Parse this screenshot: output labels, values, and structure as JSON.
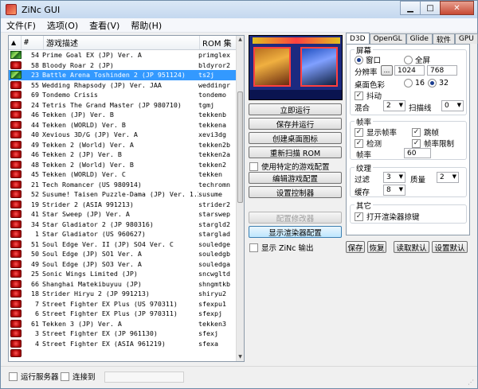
{
  "window": {
    "title": "ZiNc GUI"
  },
  "menu": [
    "文件(F)",
    "选项(O)",
    "查看(V)",
    "帮助(H)"
  ],
  "list_header": {
    "arrow": "▲",
    "num": "#",
    "desc": "游戏描述",
    "rom": "ROM 集"
  },
  "games": [
    {
      "status": "ok",
      "num": "54",
      "desc": "Prime Goal EX (JP) Ver. A",
      "rom": "primglex"
    },
    {
      "status": "bad",
      "num": "58",
      "desc": "Bloody Roar 2 (JP)",
      "rom": "bldyror2"
    },
    {
      "status": "ok",
      "num": "23",
      "desc": "Battle Arena Toshinden 2 (JP 951124)",
      "rom": "ts2j",
      "selected": true
    },
    {
      "status": "bad",
      "num": "55",
      "desc": "Wedding Rhapsody (JP) Ver. JAA",
      "rom": "weddingr"
    },
    {
      "status": "bad",
      "num": "69",
      "desc": "Tondemo Crisis",
      "rom": "tondemo"
    },
    {
      "status": "bad",
      "num": "24",
      "desc": "Tetris The Grand Master (JP 980710)",
      "rom": "tgmj"
    },
    {
      "status": "bad",
      "num": "46",
      "desc": "Tekken (JP) Ver. B",
      "rom": "tekkenb"
    },
    {
      "status": "bad",
      "num": "44",
      "desc": "Tekken (WORLD) Ver. B",
      "rom": "tekkena"
    },
    {
      "status": "bad",
      "num": "40",
      "desc": "Xevious 3D/G (JP) Ver. A",
      "rom": "xevi3dg"
    },
    {
      "status": "bad",
      "num": "49",
      "desc": "Tekken 2 (World) Ver. A",
      "rom": "tekken2b"
    },
    {
      "status": "bad",
      "num": "46",
      "desc": "Tekken 2 (JP) Ver. B",
      "rom": "tekken2a"
    },
    {
      "status": "bad",
      "num": "48",
      "desc": "Tekken 2 (World) Ver. B",
      "rom": "tekken2"
    },
    {
      "status": "bad",
      "num": "45",
      "desc": "Tekken (WORLD) Ver. C",
      "rom": "tekken"
    },
    {
      "status": "bad",
      "num": "21",
      "desc": "Tech Romancer (US 980914)",
      "rom": "techromn"
    },
    {
      "status": "bad",
      "num": "52",
      "desc": "Susume! Taisen Puzzle-Dama (JP) Ver. 1.20",
      "rom": "susume"
    },
    {
      "status": "bad",
      "num": "19",
      "desc": "Strider 2 (ASIA 991213)",
      "rom": "strider2"
    },
    {
      "status": "bad",
      "num": "41",
      "desc": "Star Sweep (JP) Ver. A",
      "rom": "starswep"
    },
    {
      "status": "bad",
      "num": "34",
      "desc": "Star Gladiator 2 (JP 980316)",
      "rom": "stargld2"
    },
    {
      "status": "bad",
      "num": "1",
      "desc": "Star Gladiator (US 960627)",
      "rom": "starglad"
    },
    {
      "status": "bad",
      "num": "51",
      "desc": "Soul Edge Ver. II (JP) SO4 Ver. C",
      "rom": "souledge"
    },
    {
      "status": "bad",
      "num": "50",
      "desc": "Soul Edge (JP) SO1 Ver. A",
      "rom": "souledgb"
    },
    {
      "status": "bad",
      "num": "49",
      "desc": "Soul Edge (JP) SO3 Ver. A",
      "rom": "souledga"
    },
    {
      "status": "bad",
      "num": "25",
      "desc": "Sonic Wings Limited (JP)",
      "rom": "sncwgltd"
    },
    {
      "status": "bad",
      "num": "66",
      "desc": "Shanghai Matekibuyuu (JP)",
      "rom": "shngmtkb"
    },
    {
      "status": "bad",
      "num": "18",
      "desc": "Strider Hiryu 2 (JP 991213)",
      "rom": "shiryu2"
    },
    {
      "status": "bad",
      "num": "7",
      "desc": "Street Fighter EX Plus (US 970311)",
      "rom": "sfexpu1"
    },
    {
      "status": "bad",
      "num": "6",
      "desc": "Street Fighter EX Plus (JP 970311)",
      "rom": "sfexpj"
    },
    {
      "status": "bad",
      "num": "61",
      "desc": "Tekken 3 (JP) Ver. A",
      "rom": "tekken3"
    },
    {
      "status": "bad",
      "num": "3",
      "desc": "Street Fighter EX (JP 961130)",
      "rom": "sfexj"
    },
    {
      "status": "bad",
      "num": "4",
      "desc": "Street Fighter EX (ASIA 961219)",
      "rom": "sfexa"
    },
    {
      "status": "bad",
      "num": "",
      "desc": "",
      "rom": ""
    }
  ],
  "preview": {
    "score": "2C0 0D"
  },
  "middle": {
    "run": "立即运行",
    "save_run": "保存并运行",
    "create_icon": "创建桌面图标",
    "rescan": "重新扫描 ROM",
    "use_specific": "使用特定的游戏配置",
    "edit_config": "编辑游戏配置",
    "controller": "设置控制器",
    "config_modifier": "配置修改器",
    "show_renderer": "显示渲染器配置",
    "show_output": "显示 ZiNc 输出"
  },
  "tabs": [
    "D3D",
    "OpenGL",
    "Glide",
    "软件",
    "GPU"
  ],
  "d3d": {
    "screen_group": "屏幕",
    "window": "窗口",
    "fullscreen": "全屏",
    "resolution_label": "分辨率",
    "res_button": "...",
    "res_w": "1024",
    "res_h": "768",
    "color_depth_label": "桌面色彩",
    "depth16": "16",
    "depth32": "32",
    "dither": "抖动",
    "blend_label": "混合",
    "blend_value": "2",
    "scanline_label": "扫描线",
    "scanline_value": "0",
    "frame_group": "帧率",
    "show_fps": "显示帧率",
    "skip_frames": "跳帧",
    "detect": "检测",
    "fps_limit": "帧率限制",
    "fps_label": "帧率",
    "fps_value": "60",
    "texture_group": "纹理",
    "filter_label": "过滤",
    "filter_value": "3",
    "quality_label": "质量",
    "quality_value": "2",
    "cache_label": "缓存",
    "cache_value": "8",
    "other_group": "其它",
    "open_renderer": "打开渲染器掠键"
  },
  "bottom_buttons": {
    "save": "保存",
    "restore": "恢复",
    "load_default": "读取默认",
    "set_default": "设置默认"
  },
  "status": {
    "run_server": "运行服务器",
    "connect": "连接到"
  }
}
